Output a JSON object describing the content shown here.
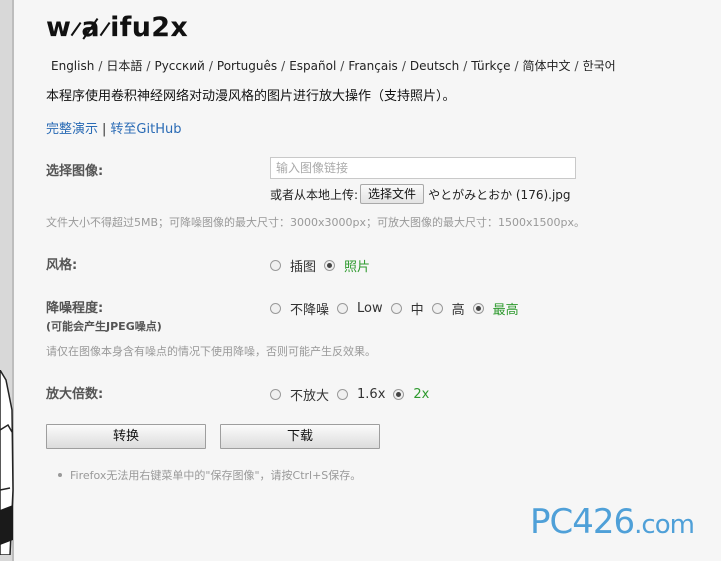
{
  "logo": {
    "part1": "w",
    "slash1": "/",
    "part2": "a",
    "slash2": "/",
    "part3": "ifu2x"
  },
  "languages": [
    "English",
    "日本語",
    "Русский",
    "Português",
    "Español",
    "Français",
    "Deutsch",
    "Türkçe",
    "简体中文",
    "한국어"
  ],
  "language_separator": "/",
  "description": "本程序使用卷积神经网络对动漫风格的图片进行放大操作（支持照片）。",
  "links": {
    "demo": "完整演示",
    "separator": "|",
    "github": "转至GitHub"
  },
  "image_select": {
    "label": "选择图像:",
    "url_placeholder": "输入图像链接",
    "upload_label": "或者从本地上传:",
    "file_button": "选择文件",
    "file_name": "やとがみとおか (176).jpg",
    "limits_note": "文件大小不得超过5MB；可降噪图像的最大尺寸：3000x3000px；可放大图像的最大尺寸：1500x1500px。"
  },
  "style": {
    "label": "风格:",
    "options": [
      {
        "label": "插图",
        "selected": false
      },
      {
        "label": "照片",
        "selected": true
      }
    ]
  },
  "noise": {
    "label": "降噪程度:",
    "sublabel": "(可能会产生JPEG噪点)",
    "options": [
      {
        "label": "不降噪",
        "selected": false
      },
      {
        "label": "Low",
        "selected": false
      },
      {
        "label": "中",
        "selected": false
      },
      {
        "label": "高",
        "selected": false
      },
      {
        "label": "最高",
        "selected": true
      }
    ],
    "note": "请仅在图像本身含有噪点的情况下使用降噪，否则可能产生反效果。"
  },
  "scale": {
    "label": "放大倍数:",
    "options": [
      {
        "label": "不放大",
        "selected": false
      },
      {
        "label": "1.6x",
        "selected": false
      },
      {
        "label": "2x",
        "selected": true
      }
    ]
  },
  "buttons": {
    "convert": "转换",
    "download": "下载"
  },
  "tip": "Firefox无法用右键菜单中的\"保存图像\"，请按Ctrl+S保存。",
  "watermark": {
    "main": "PC426",
    "suffix": ".com"
  },
  "colors": {
    "link": "#2a6bb5",
    "selected_option": "#2e9a2e",
    "note": "#999999",
    "watermark": "#4fa0d8"
  }
}
